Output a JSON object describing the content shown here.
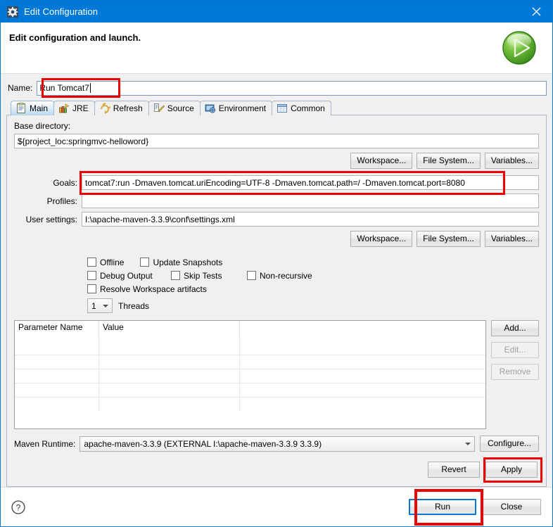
{
  "window": {
    "title": "Edit Configuration",
    "title_icon": "gear-icon",
    "close_icon": "close-icon",
    "accent_color": "#0078d7",
    "annotation_color": "#ee0000"
  },
  "header": {
    "title": "Edit configuration and launch.",
    "icon": "green-run-play-icon"
  },
  "name": {
    "label": "Name:",
    "value": "Run Tomcat7",
    "placeholder": ""
  },
  "tabs": [
    {
      "label": "Main",
      "icon": "clipboard-icon",
      "selected": true
    },
    {
      "label": "JRE",
      "icon": "books-icon",
      "selected": false
    },
    {
      "label": "Refresh",
      "icon": "refresh-arrows-icon",
      "selected": false
    },
    {
      "label": "Source",
      "icon": "source-pencil-icon",
      "selected": false
    },
    {
      "label": "Environment",
      "icon": "environment-monitor-icon",
      "selected": false
    },
    {
      "label": "Common",
      "icon": "common-table-icon",
      "selected": false
    }
  ],
  "main": {
    "base_directory": {
      "label": "Base directory:",
      "value": "${project_loc:springmvc-helloword}"
    },
    "browse_buttons_top": [
      {
        "label": "Workspace..."
      },
      {
        "label": "File System..."
      },
      {
        "label": "Variables..."
      }
    ],
    "goals": {
      "label": "Goals:",
      "value": "tomcat7:run -Dmaven.tomcat.uriEncoding=UTF-8 -Dmaven.tomcat.path=/ -Dmaven.tomcat.port=8080",
      "highlighted": true
    },
    "profiles": {
      "label": "Profiles:",
      "value": ""
    },
    "user_settings": {
      "label": "User settings:",
      "value": "I:\\apache-maven-3.3.9\\conf\\settings.xml"
    },
    "browse_buttons_bottom": [
      {
        "label": "Workspace..."
      },
      {
        "label": "File System..."
      },
      {
        "label": "Variables..."
      }
    ],
    "checkboxes_row1": [
      {
        "label": "Offline",
        "checked": false
      },
      {
        "label": "Update Snapshots",
        "checked": false
      }
    ],
    "checkboxes_row2": [
      {
        "label": "Debug Output",
        "checked": false
      },
      {
        "label": "Skip Tests",
        "checked": false
      },
      {
        "label": "Non-recursive",
        "checked": false
      }
    ],
    "checkboxes_row3": [
      {
        "label": "Resolve Workspace artifacts",
        "checked": false
      }
    ],
    "threads": {
      "value": "1",
      "label": "Threads"
    },
    "parameters_table": {
      "columns": [
        "Parameter Name",
        "Value",
        ""
      ],
      "rows": [],
      "empty_row_count": 5
    },
    "table_buttons": [
      {
        "label": "Add...",
        "enabled": true
      },
      {
        "label": "Edit...",
        "enabled": false
      },
      {
        "label": "Remove",
        "enabled": false
      }
    ],
    "maven_runtime": {
      "label": "Maven Runtime:",
      "value": "apache-maven-3.3.9 (EXTERNAL I:\\apache-maven-3.3.9 3.3.9)",
      "configure_label": "Configure..."
    },
    "revert_label": "Revert",
    "apply_label": "Apply",
    "apply_highlighted": true
  },
  "footer": {
    "help_icon": "question-mark-icon",
    "run_label": "Run",
    "close_label": "Close",
    "run_highlighted": true,
    "run_is_default": true
  }
}
